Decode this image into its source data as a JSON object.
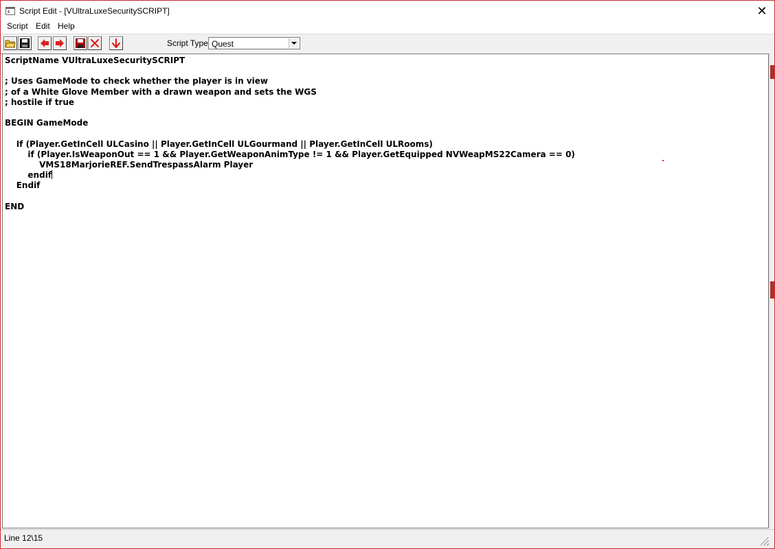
{
  "window": {
    "title": "Script Edit - [VUltraLuxeSecuritySCRIPT]",
    "close_glyph": "✕"
  },
  "menu": {
    "items": [
      "Script",
      "Edit",
      "Help"
    ]
  },
  "toolbar": {
    "buttons": [
      {
        "name": "open-icon",
        "color": "#d4a017"
      },
      {
        "name": "save-icon",
        "color": "#000000"
      },
      {
        "name": "previous-script-icon",
        "color": "#e02020"
      },
      {
        "name": "next-script-icon",
        "color": "#e02020"
      },
      {
        "name": "save-red-icon",
        "color": "#c00000"
      },
      {
        "name": "delete-icon",
        "color": "#e02020"
      },
      {
        "name": "down-arrow-icon",
        "color": "#e02020"
      }
    ],
    "script_type_label": "Script Type",
    "script_type_value": "Quest"
  },
  "editor": {
    "lines": [
      "ScriptName VUltraLuxeSecuritySCRIPT",
      "",
      "; Uses GameMode to check whether the player is in view",
      "; of a White Glove Member with a drawn weapon and sets the WGS",
      "; hostile if true",
      "",
      "BEGIN GameMode",
      "",
      "    If (Player.GetInCell ULCasino || Player.GetInCell ULGourmand || Player.GetInCell ULRooms)",
      "        if (Player.IsWeaponOut == 1 && Player.GetWeaponAnimType != 1 && Player.GetEquipped NVWeapMS22Camera == 0)",
      "            VMS18MarjorieREF.SendTrespassAlarm Player",
      "        endif",
      "    Endif",
      "",
      "END"
    ],
    "caret_line": 12
  },
  "status": {
    "text": "Line 12\\15"
  }
}
